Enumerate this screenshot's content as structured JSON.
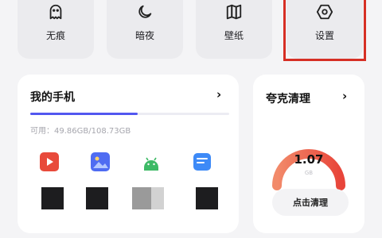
{
  "toolbar": {
    "items": [
      {
        "label": "无痕",
        "icon": "ghost-icon"
      },
      {
        "label": "暗夜",
        "icon": "moon-icon"
      },
      {
        "label": "壁纸",
        "icon": "book-icon"
      },
      {
        "label": "设置",
        "icon": "settings-icon"
      }
    ]
  },
  "phone_card": {
    "title": "我的手机",
    "chevron": "›",
    "storage_text": "可用：49.86GB/108.73GB",
    "storage_used_fraction": 0.54,
    "apps": [
      {
        "icon": "video-app-icon",
        "color": "#e84a3b"
      },
      {
        "icon": "gallery-app-icon",
        "color": "#4f6cf2"
      },
      {
        "icon": "android-app-icon",
        "color": "#3dba66"
      },
      {
        "icon": "files-app-icon",
        "color": "#3d8af7"
      }
    ]
  },
  "clean_card": {
    "title": "夸克清理",
    "chevron": "›",
    "value": "1.07",
    "unit": "GB",
    "button_label": "点击清理"
  },
  "colors": {
    "accent": "#5257f0",
    "highlight": "#d62f25",
    "gauge_start": "#f28a6a",
    "gauge_end": "#e8453a"
  }
}
